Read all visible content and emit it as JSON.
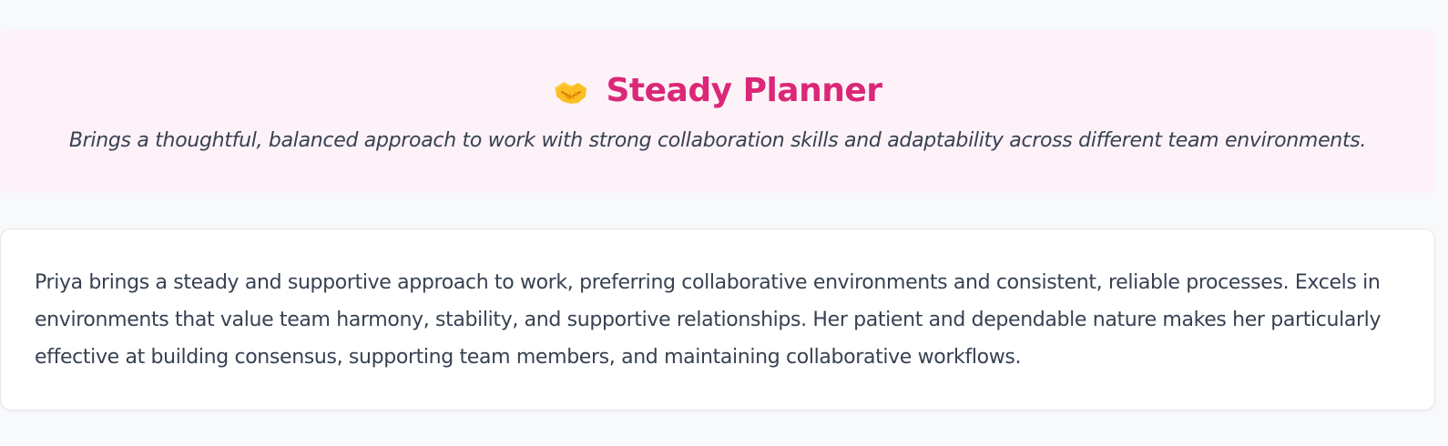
{
  "profile": {
    "icon": "handshake-icon",
    "title": "Steady Planner",
    "subtitle": "Brings a thoughtful, balanced approach to work with strong collaboration skills and adaptability across different team environments.",
    "accent_color": "#db2777",
    "banner_color": "#fdf2f8"
  },
  "summary": {
    "text": "Priya brings a steady and supportive approach to work, preferring collaborative environments and consistent, reliable processes. Excels in environments that value team harmony, stability, and supportive relationships. Her patient and dependable nature makes her particularly effective at building consensus, supporting team members, and maintaining collaborative workflows."
  }
}
